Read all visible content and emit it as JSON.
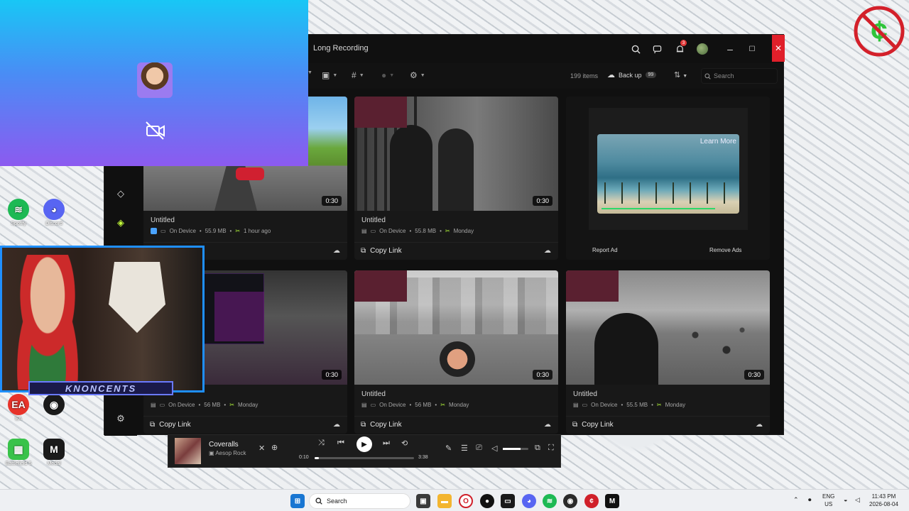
{
  "window": {
    "title": "Long Recording",
    "notification_count": "3"
  },
  "toolbar": {
    "item_count": "199 items",
    "backup_label": "Back up",
    "backup_badge": "99",
    "search_placeholder": "Search"
  },
  "cards": [
    {
      "title": "Untitled",
      "location": "On Device",
      "size": "55.9 MB",
      "time": "1 hour ago",
      "duration": "0:30",
      "copy_label": "",
      "theme": "fortnite"
    },
    {
      "title": "Untitled",
      "location": "On Device",
      "size": "55.8 MB",
      "time": "Monday",
      "duration": "0:30",
      "copy_label": "Copy Link",
      "theme": "jail"
    },
    {
      "title": "",
      "location": "On Device",
      "size": "56 MB",
      "time": "Monday",
      "duration": "0:30",
      "copy_label": "Copy Link",
      "theme": "menu"
    },
    {
      "title": "Untitled",
      "location": "On Device",
      "size": "56 MB",
      "time": "Monday",
      "duration": "0:30",
      "copy_label": "Copy Link",
      "theme": "bike"
    },
    {
      "title": "Untitled",
      "location": "On Device",
      "size": "55.5 MB",
      "time": "Monday",
      "duration": "0:30",
      "copy_label": "Copy Link",
      "theme": "street"
    }
  ],
  "ad": {
    "learn_more": "Learn More",
    "report": "Report Ad",
    "remove": "Remove Ads"
  },
  "desktop": {
    "icons": [
      {
        "label": "Spotify",
        "color": "#1db954"
      },
      {
        "label": "Discord",
        "color": "#5865f2"
      },
      {
        "label": "EA",
        "color": "#e7332a"
      },
      {
        "label": "",
        "color": "#1a1a1a"
      },
      {
        "label": "Battlefield 6",
        "color": "#39c24a"
      },
      {
        "label": "Medal",
        "color": "#1a1a1a"
      }
    ]
  },
  "webcam": {
    "brand": "KNONCENTS"
  },
  "player": {
    "track": "Coveralls",
    "artist": "Aesop Rock",
    "elapsed": "0:10",
    "total": "3:38",
    "progress": 0.046,
    "volume": 0.7
  },
  "taskbar": {
    "search_label": "Search",
    "lang_line1": "ENG",
    "lang_line2": "US",
    "time": "11:43 PM",
    "date": "2026-08-04"
  }
}
